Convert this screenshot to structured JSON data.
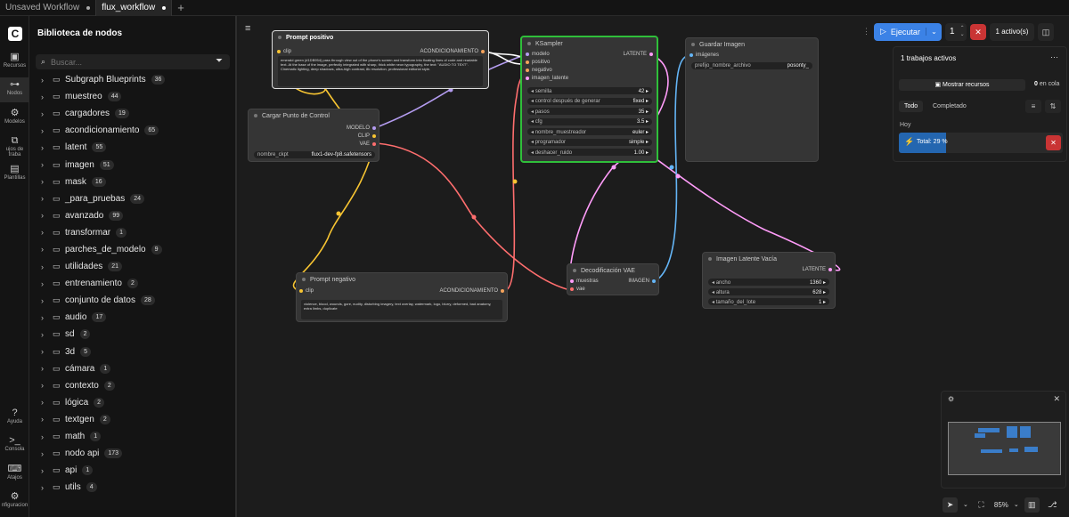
{
  "tabs": [
    {
      "label": "Unsaved Workflow",
      "active": false
    },
    {
      "label": "flux_workflow",
      "active": true
    }
  ],
  "sidebar_icons": [
    {
      "icon": "cube-icon",
      "label": "Recursos"
    },
    {
      "icon": "nodes-icon",
      "label": "Nodos"
    },
    {
      "icon": "models-icon",
      "label": "Modelos"
    },
    {
      "icon": "workflows-icon",
      "label": "ujos de traba"
    },
    {
      "icon": "templates-icon",
      "label": "Plantillas"
    },
    {
      "icon": "help-icon",
      "label": "Ayuda"
    },
    {
      "icon": "console-icon",
      "label": "Consola"
    },
    {
      "icon": "keyboard-icon",
      "label": "Atajos"
    },
    {
      "icon": "gear-icon",
      "label": "nfiguracion"
    }
  ],
  "library": {
    "title": "Biblioteca de nodos",
    "search_placeholder": "Buscar...",
    "items": [
      {
        "label": "Subgraph Blueprints",
        "count": "36"
      },
      {
        "label": "muestreo",
        "count": "44"
      },
      {
        "label": "cargadores",
        "count": "19"
      },
      {
        "label": "acondicionamiento",
        "count": "65"
      },
      {
        "label": "latent",
        "count": "55"
      },
      {
        "label": "imagen",
        "count": "51"
      },
      {
        "label": "mask",
        "count": "16"
      },
      {
        "label": "_para_pruebas",
        "count": "24"
      },
      {
        "label": "avanzado",
        "count": "99"
      },
      {
        "label": "transformar",
        "count": "1"
      },
      {
        "label": "parches_de_modelo",
        "count": "9"
      },
      {
        "label": "utilidades",
        "count": "21"
      },
      {
        "label": "entrenamiento",
        "count": "2"
      },
      {
        "label": "conjunto de datos",
        "count": "28"
      },
      {
        "label": "audio",
        "count": "17"
      },
      {
        "label": "sd",
        "count": "2"
      },
      {
        "label": "3d",
        "count": "5"
      },
      {
        "label": "cámara",
        "count": "1"
      },
      {
        "label": "contexto",
        "count": "2"
      },
      {
        "label": "lógica",
        "count": "2"
      },
      {
        "label": "textgen",
        "count": "2"
      },
      {
        "label": "math",
        "count": "1"
      },
      {
        "label": "nodo api",
        "count": "173"
      },
      {
        "label": "api",
        "count": "1"
      },
      {
        "label": "utils",
        "count": "4"
      }
    ]
  },
  "nodes": {
    "prompt_pos": {
      "title": "Prompt positivo",
      "in_clip": "clip",
      "out": "ACONDICIONAMIENTO",
      "text": "emerald green (#1DB954) pass through view out of the phone's screen and transform into floating lines of code and readable text. At the base of the image, perfectly integrated with sharp, thick white neon typography, the text: \"AUDIO TO TEXT\". Cinematic lighting, deep shadows, ultra-high contrast, 8k resolution, professional editorial style."
    },
    "loader": {
      "title": "Cargar Punto de Control",
      "out_model": "MODELO",
      "out_clip": "CLIP",
      "out_vae": "VAE",
      "w_label": "nombre_ckpt",
      "w_value": "flux1-dev-fp8.safetensors"
    },
    "ksampler": {
      "title": "KSampler",
      "in_model": "modelo",
      "in_pos": "positivo",
      "in_neg": "negativo",
      "in_latent": "imagen_latente",
      "out": "LATENTE",
      "widgets": [
        {
          "label": "semilla",
          "value": "42"
        },
        {
          "label": "control después de generar",
          "value": "fixed"
        },
        {
          "label": "pasos",
          "value": "35"
        },
        {
          "label": "cfg",
          "value": "3.5"
        },
        {
          "label": "nombre_muestreador",
          "value": "euler"
        },
        {
          "label": "programador",
          "value": "simple"
        },
        {
          "label": "deshacer_ruido",
          "value": "1.00"
        }
      ]
    },
    "save": {
      "title": "Guardar Imagen",
      "in_images": "imágenes",
      "w_label": "prefijo_nombre_archivo",
      "w_value": "posonty_"
    },
    "prompt_neg": {
      "title": "Prompt negativo",
      "in_clip": "clip",
      "out": "ACONDICIONAMIENTO",
      "text": "violence, blood, wounds, gore, nudity, disturbing imagery, text overlay, watermark, logo, blurry, deformed, bad anatomy, extra limbs, duplicate"
    },
    "vae": {
      "title": "Decodificación VAE",
      "in_samples": "muestras",
      "in_vae": "vae",
      "out": "IMAGEN"
    },
    "latent": {
      "title": "Imagen Latente Vacía",
      "out": "LATENTE",
      "widgets": [
        {
          "label": "ancho",
          "value": "1360"
        },
        {
          "label": "altura",
          "value": "628"
        },
        {
          "label": "tamaño_del_lote",
          "value": "1"
        }
      ]
    }
  },
  "runbar": {
    "run_label": "Ejecutar",
    "count": "1",
    "active_label": "1 activo(s)"
  },
  "jobs": {
    "title": "1 trabajos activos",
    "show_resources": "Mostrar recursos",
    "queue_count": "0",
    "queue_label": "en cola",
    "tab_all": "Todo",
    "tab_done": "Completado",
    "day": "Hoy",
    "progress_label": "Total: 29 %",
    "progress": 0.29
  },
  "zoom": {
    "level": "85%"
  },
  "colors": {
    "accent": "#3b82e6",
    "danger": "#c93434",
    "ksampler_border": "#2fbf3a",
    "wire_model": "#b49cf0",
    "wire_clip": "#f7c432",
    "wire_vae": "#ff6e6e",
    "wire_latent": "#ff9cf9",
    "wire_image": "#64b5f6",
    "wire_cond": "#ffffff"
  }
}
